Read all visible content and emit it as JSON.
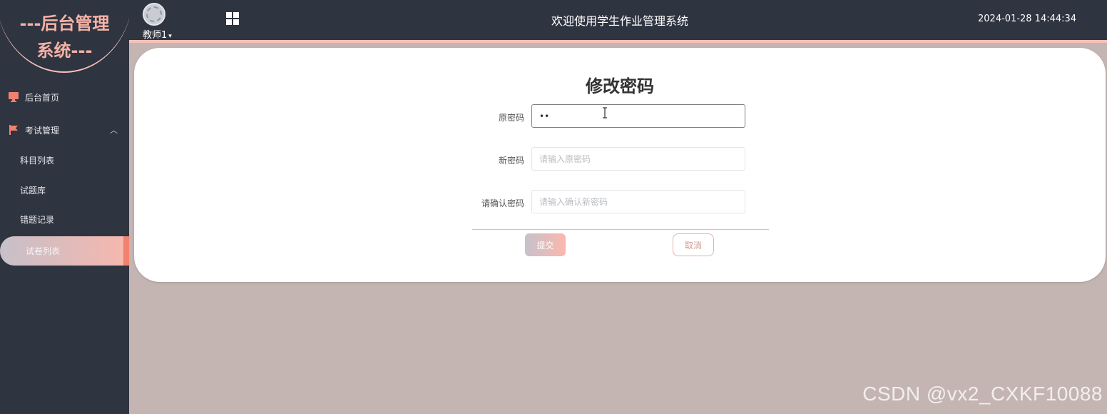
{
  "sidebar": {
    "logo_line1": "---后台管理",
    "logo_line2": "系统---",
    "items": [
      {
        "label": "后台首页",
        "icon": "monitor-icon"
      },
      {
        "label": "考试管理",
        "icon": "flag-icon",
        "expanded": true,
        "children": [
          {
            "label": "科目列表"
          },
          {
            "label": "试题库"
          },
          {
            "label": "错题记录"
          },
          {
            "label": "试卷列表",
            "active": true
          }
        ]
      }
    ]
  },
  "header": {
    "username": "教师1",
    "title": "欢迎使用学生作业管理系统",
    "time": "2024-01-28 14:44:34"
  },
  "form": {
    "title": "修改密码",
    "old_label": "原密码",
    "old_value": "••",
    "new_label": "新密码",
    "new_placeholder": "请输入原密码",
    "confirm_label": "请确认密码",
    "confirm_placeholder": "请输入确认新密码",
    "submit_label": "提交",
    "cancel_label": "取消"
  },
  "colors": {
    "sidebar_bg": "#2f3441",
    "accent": "#f5b2a6",
    "active_bar": "#f2826f",
    "page_bg": "#c4b5b3"
  },
  "watermark": "CSDN @vx2_CXKF10088"
}
